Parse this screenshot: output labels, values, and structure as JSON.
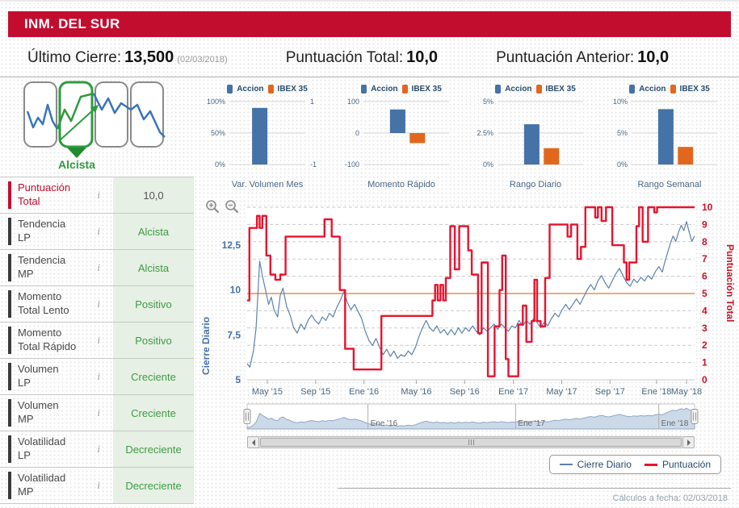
{
  "header": {
    "title": "INM. DEL SUR"
  },
  "summary": {
    "ultimo_cierre": {
      "label": "Último Cierre:",
      "value": "13,500",
      "date": "(02/03/2018)"
    },
    "puntuacion_total": {
      "label": "Puntuación Total:",
      "value": "10,0"
    },
    "puntuacion_anterior": {
      "label": "Puntuación Anterior:",
      "value": "10,0"
    }
  },
  "trend_graphic": {
    "label": "Alcista"
  },
  "icons": {
    "info": "i"
  },
  "indicators": [
    {
      "line1": "Puntuación",
      "line2": "Total",
      "value": "10,0",
      "highlight": true
    },
    {
      "line1": "Tendencia",
      "line2": "LP",
      "value": "Alcista"
    },
    {
      "line1": "Tendencia",
      "line2": "MP",
      "value": "Alcista"
    },
    {
      "line1": "Momento",
      "line2": "Total Lento",
      "value": "Positivo"
    },
    {
      "line1": "Momento",
      "line2": "Total Rápido",
      "value": "Positivo"
    },
    {
      "line1": "Volumen",
      "line2": "LP",
      "value": "Creciente"
    },
    {
      "line1": "Volumen",
      "line2": "MP",
      "value": "Creciente"
    },
    {
      "line1": "Volatilidad",
      "line2": "LP",
      "value": "Decreciente"
    },
    {
      "line1": "Volatilidad",
      "line2": "MP",
      "value": "Decreciente"
    }
  ],
  "colors": {
    "header_bg": "#c30d2f",
    "accent_red": "#cc1228",
    "series_red": "#e8132e",
    "series_blue": "#5d82ad",
    "bar_blue": "#4572a7",
    "bar_orange": "#e2671c",
    "green_text": "#3f9b45",
    "green_bg": "#e6f0e4",
    "threshold_orange": "#edaa7d",
    "axis_steel": "#4a6785",
    "legend_navy": "#274b6d",
    "nav_fill": "#ccd9e8",
    "nav_stroke": "#92a8c2"
  },
  "chart_data": [
    {
      "id": "var-volumen-mes",
      "type": "bar",
      "title": "Var. Volumen Mes",
      "legend": [
        "Accion",
        "IBEX 35"
      ],
      "left_ticks": [
        "100%",
        "50%",
        "0%"
      ],
      "right_ticks": [
        "1",
        "-1"
      ],
      "ymin": 0,
      "ymax": 100,
      "values": [
        90,
        null
      ]
    },
    {
      "id": "momento-rapido",
      "type": "bar",
      "title": "Momento Rápido",
      "legend": [
        "Accion",
        "IBEX 35"
      ],
      "left_ticks": [
        "100",
        "0",
        "-100"
      ],
      "right_ticks": [],
      "ymin": -100,
      "ymax": 100,
      "values": [
        75,
        -32
      ]
    },
    {
      "id": "rango-diario",
      "type": "bar",
      "title": "Rango Diario",
      "legend": [
        "Accion",
        "IBEX 35"
      ],
      "left_ticks": [
        "5%",
        "2.5%",
        "0%"
      ],
      "right_ticks": [],
      "ymin": 0,
      "ymax": 5,
      "values": [
        3.2,
        1.3
      ]
    },
    {
      "id": "rango-semanal",
      "type": "bar",
      "title": "Rango Semanal",
      "legend": [
        "Accion",
        "IBEX 35"
      ],
      "left_ticks": [
        "10%",
        "5%",
        "0%"
      ],
      "right_ticks": [],
      "ymin": 0,
      "ymax": 10,
      "values": [
        8.8,
        2.8
      ]
    },
    {
      "id": "price-score-chart",
      "type": "line",
      "y_left": {
        "title": "Cierre Diario",
        "ticks": [
          "5",
          "7,5",
          "10",
          "12,5"
        ],
        "tick_values": [
          5,
          7.5,
          10,
          12.5
        ],
        "min": 5,
        "max": 14.6
      },
      "y_right": {
        "title": "Puntuación Total",
        "ticks": [
          0,
          1,
          2,
          3,
          4,
          5,
          6,
          7,
          8,
          9,
          10
        ],
        "min": 0,
        "max": 10
      },
      "x_ticks": [
        {
          "label": "May '15",
          "x": 4.5
        },
        {
          "label": "Sep '15",
          "x": 15.3
        },
        {
          "label": "Ene '16",
          "x": 26.1
        },
        {
          "label": "May '16",
          "x": 37.8
        },
        {
          "label": "Sep '16",
          "x": 48.6
        },
        {
          "label": "Ene '17",
          "x": 59.5
        },
        {
          "label": "May '17",
          "x": 70.3
        },
        {
          "label": "Sep '17",
          "x": 81.1
        },
        {
          "label": "Ene '18",
          "x": 91.5
        },
        {
          "label": "May '18",
          "x": 98.2
        }
      ],
      "threshold_value": 5,
      "navigator": {
        "labels": [
          {
            "label": "Ene '16",
            "x": 27
          },
          {
            "label": "Ene '17",
            "x": 60
          },
          {
            "label": "Ene '18",
            "x": 92
          }
        ]
      },
      "series": [
        {
          "name": "Cierre Diario",
          "axis": "left",
          "step": false,
          "points": [
            [
              0,
              5.9
            ],
            [
              0.6,
              5.7
            ],
            [
              1.4,
              6.6
            ],
            [
              2,
              7.9
            ],
            [
              2.8,
              11.6
            ],
            [
              3.4,
              10.8
            ],
            [
              4,
              10.1
            ],
            [
              4.8,
              9.2
            ],
            [
              5.4,
              9.6
            ],
            [
              6,
              8.9
            ],
            [
              6.8,
              8.5
            ],
            [
              7.4,
              9.7
            ],
            [
              8,
              10.1
            ],
            [
              8.8,
              9.1
            ],
            [
              9.6,
              8.6
            ],
            [
              10.4,
              7.9
            ],
            [
              11.2,
              7.6
            ],
            [
              12,
              8.1
            ],
            [
              12.8,
              7.8
            ],
            [
              13.6,
              8.3
            ],
            [
              14.4,
              8.6
            ],
            [
              15.2,
              8.3
            ],
            [
              16,
              8.1
            ],
            [
              16.8,
              8.5
            ],
            [
              17.6,
              8.3
            ],
            [
              18.4,
              8.7
            ],
            [
              19.2,
              8.5
            ],
            [
              20,
              9
            ],
            [
              20.8,
              9.4
            ],
            [
              21.6,
              9.9
            ],
            [
              22.4,
              9.3
            ],
            [
              23.2,
              8.9
            ],
            [
              24,
              9.2
            ],
            [
              24.8,
              8.8
            ],
            [
              25.6,
              8.4
            ],
            [
              26.4,
              7.7
            ],
            [
              27.2,
              7.2
            ],
            [
              28,
              6.9
            ],
            [
              28.8,
              7.3
            ],
            [
              29.6,
              6.8
            ],
            [
              30.4,
              6.4
            ],
            [
              31.2,
              6.7
            ],
            [
              32,
              6.3
            ],
            [
              32.8,
              6.6
            ],
            [
              33.6,
              6.2
            ],
            [
              34.4,
              6.4
            ],
            [
              35.2,
              6.3
            ],
            [
              36,
              6.6
            ],
            [
              36.8,
              6.4
            ],
            [
              37.6,
              6.8
            ],
            [
              38.4,
              7.4
            ],
            [
              39.2,
              7.9
            ],
            [
              40,
              8.3
            ],
            [
              40.8,
              7.9
            ],
            [
              41.6,
              7.7
            ],
            [
              42.4,
              8
            ],
            [
              43.2,
              7.6
            ],
            [
              44,
              7.8
            ],
            [
              44.8,
              7.5
            ],
            [
              45.6,
              7.8
            ],
            [
              46.4,
              7.5
            ],
            [
              47.2,
              7.9
            ],
            [
              48,
              7.6
            ],
            [
              48.8,
              7.9
            ],
            [
              49.6,
              7.7
            ],
            [
              50.4,
              8
            ],
            [
              51.2,
              7.7
            ],
            [
              52,
              7.5
            ],
            [
              52.8,
              7.9
            ],
            [
              53.6,
              7.7
            ],
            [
              54.4,
              7.9
            ],
            [
              55.2,
              8.1
            ],
            [
              56,
              7.8
            ],
            [
              56.8,
              8.1
            ],
            [
              57.6,
              7.9
            ],
            [
              58.4,
              7.7
            ],
            [
              59.2,
              8
            ],
            [
              60,
              7.9
            ],
            [
              60.8,
              8.3
            ],
            [
              61.6,
              8
            ],
            [
              62.4,
              8.3
            ],
            [
              63.2,
              8.1
            ],
            [
              64,
              8.4
            ],
            [
              64.8,
              8.2
            ],
            [
              65.6,
              7.9
            ],
            [
              66.4,
              8.2
            ],
            [
              67.2,
              8
            ],
            [
              68,
              8.4
            ],
            [
              68.8,
              8.7
            ],
            [
              69.6,
              8.5
            ],
            [
              70.4,
              8.9
            ],
            [
              71.2,
              9.2
            ],
            [
              72,
              8.9
            ],
            [
              72.8,
              9.2
            ],
            [
              73.6,
              9.5
            ],
            [
              74.4,
              9.2
            ],
            [
              75.2,
              9.6
            ],
            [
              76,
              10
            ],
            [
              76.8,
              10.3
            ],
            [
              77.6,
              10
            ],
            [
              78.4,
              10.5
            ],
            [
              79.2,
              10.8
            ],
            [
              80,
              10.4
            ],
            [
              80.8,
              10.1
            ],
            [
              81.6,
              10.5
            ],
            [
              82.4,
              10.9
            ],
            [
              83.2,
              11.2
            ],
            [
              84,
              10.8
            ],
            [
              84.8,
              10.4
            ],
            [
              85.6,
              10.2
            ],
            [
              86.4,
              10.6
            ],
            [
              87.2,
              10.4
            ],
            [
              88,
              10.7
            ],
            [
              88.8,
              10.5
            ],
            [
              89.6,
              10.8
            ],
            [
              90.4,
              10.6
            ],
            [
              91.2,
              11
            ],
            [
              92,
              11.3
            ],
            [
              92.8,
              11
            ],
            [
              93.4,
              11.6
            ],
            [
              94,
              12.1
            ],
            [
              94.6,
              12.6
            ],
            [
              95.2,
              13
            ],
            [
              95.8,
              12.7
            ],
            [
              96.4,
              13.2
            ],
            [
              97,
              13.6
            ],
            [
              97.6,
              13.3
            ],
            [
              98.2,
              13.8
            ],
            [
              98.8,
              13.2
            ],
            [
              99.4,
              12.7
            ],
            [
              100,
              13
            ]
          ]
        },
        {
          "name": "Puntuación",
          "axis": "right",
          "step": true,
          "points": [
            [
              0,
              4.6
            ],
            [
              0.5,
              8.8
            ],
            [
              2.2,
              9.5
            ],
            [
              2.8,
              8.8
            ],
            [
              3.4,
              9.5
            ],
            [
              4.3,
              7.2
            ],
            [
              5.2,
              6.1
            ],
            [
              6.3,
              5.8
            ],
            [
              7.4,
              6.1
            ],
            [
              8.6,
              8.3
            ],
            [
              17.3,
              9.3
            ],
            [
              18.9,
              8.3
            ],
            [
              20.7,
              5.2
            ],
            [
              21.9,
              1.8
            ],
            [
              23.8,
              0.6
            ],
            [
              30,
              3.7
            ],
            [
              41.4,
              4.6
            ],
            [
              42,
              5.5
            ],
            [
              42.6,
              4.6
            ],
            [
              43.2,
              5.5
            ],
            [
              43.8,
              4.6
            ],
            [
              44.4,
              5.9
            ],
            [
              45.4,
              8.9
            ],
            [
              46.4,
              6.4
            ],
            [
              47.4,
              8.9
            ],
            [
              49.4,
              7.5
            ],
            [
              50.2,
              6.1
            ],
            [
              51.6,
              2.7
            ],
            [
              52.4,
              6.8
            ],
            [
              53.8,
              0.2
            ],
            [
              55.3,
              3.1
            ],
            [
              56.4,
              5.2
            ],
            [
              57,
              7.2
            ],
            [
              57.8,
              1.2
            ],
            [
              58.4,
              0.2
            ],
            [
              60.6,
              3.2
            ],
            [
              61.6,
              4.3
            ],
            [
              62.4,
              2.2
            ],
            [
              63.6,
              3.4
            ],
            [
              64.2,
              5.8
            ],
            [
              64.8,
              3.4
            ],
            [
              65.6,
              3.1
            ],
            [
              66.6,
              5.9
            ],
            [
              67.6,
              9
            ],
            [
              71.6,
              8.3
            ],
            [
              72.4,
              9
            ],
            [
              73.8,
              7
            ],
            [
              74.6,
              7.7
            ],
            [
              75.6,
              10
            ],
            [
              77.8,
              9.4
            ],
            [
              78.4,
              10
            ],
            [
              79.2,
              9.2
            ],
            [
              80.2,
              10
            ],
            [
              81.6,
              7.8
            ],
            [
              84.2,
              6.8
            ],
            [
              84.8,
              5.8
            ],
            [
              85.4,
              6.8
            ],
            [
              87,
              8.9
            ],
            [
              87.6,
              10
            ],
            [
              88.4,
              8
            ],
            [
              89.6,
              10
            ],
            [
              91,
              9.7
            ],
            [
              91.6,
              10
            ]
          ]
        }
      ]
    }
  ],
  "footer": {
    "text": "Cálculos a fecha: 02/03/2018"
  }
}
